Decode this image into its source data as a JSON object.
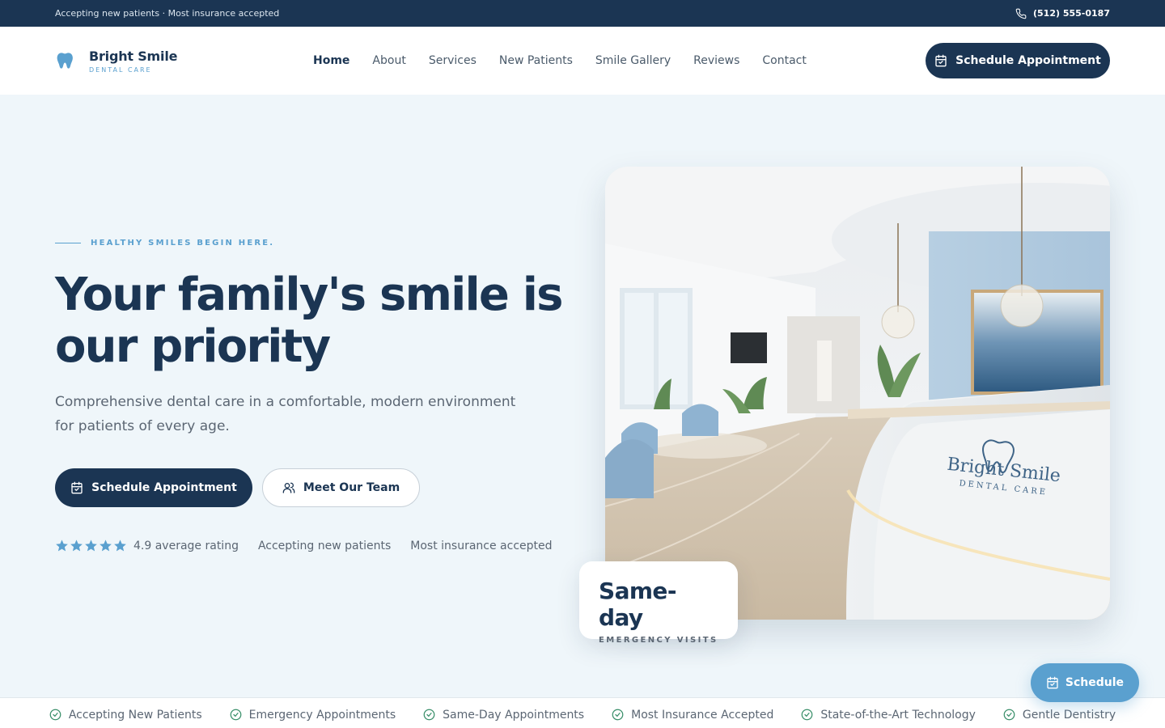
{
  "topbar": {
    "announcement": "Accepting new patients · Most insurance accepted",
    "phone": "(512) 555-0187",
    "phone_icon": "phone-icon"
  },
  "brand": {
    "name": "Bright Smile",
    "tagline": "DENTAL CARE",
    "logo_icon": "tooth-icon",
    "colors": {
      "navy": "#1b3553",
      "accent": "#5aa0cf",
      "background": "#eff6fa"
    }
  },
  "nav": {
    "items": [
      {
        "label": "Home",
        "active": true
      },
      {
        "label": "About",
        "active": false
      },
      {
        "label": "Services",
        "active": false
      },
      {
        "label": "New Patients",
        "active": false
      },
      {
        "label": "Smile Gallery",
        "active": false
      },
      {
        "label": "Reviews",
        "active": false
      },
      {
        "label": "Contact",
        "active": false
      }
    ],
    "cta_label": "Schedule Appointment",
    "cta_icon": "calendar-icon"
  },
  "hero": {
    "eyebrow": "HEALTHY SMILES BEGIN HERE.",
    "headline": "Your family's smile is our priority",
    "subtext": "Comprehensive dental care in a comfortable, modern environment for patients of every age.",
    "primary_cta": "Schedule Appointment",
    "secondary_cta": "Meet Our Team",
    "secondary_icon": "users-icon",
    "rating_stars": 5,
    "rating_text": "4.9 average rating",
    "trust_1": "Accepting new patients",
    "trust_2": "Most insurance accepted"
  },
  "photo": {
    "desk_logo_name": "Bright Smile",
    "desk_logo_sub": "DENTAL CARE"
  },
  "badge": {
    "title": "Same-day",
    "subtitle": "EMERGENCY VISITS"
  },
  "floating_button": {
    "label": "Schedule",
    "icon": "calendar-icon"
  },
  "features": [
    "Accepting New Patients",
    "Emergency Appointments",
    "Same-Day Appointments",
    "Most Insurance Accepted",
    "State-of-the-Art Technology",
    "Gentle Dentistry"
  ]
}
